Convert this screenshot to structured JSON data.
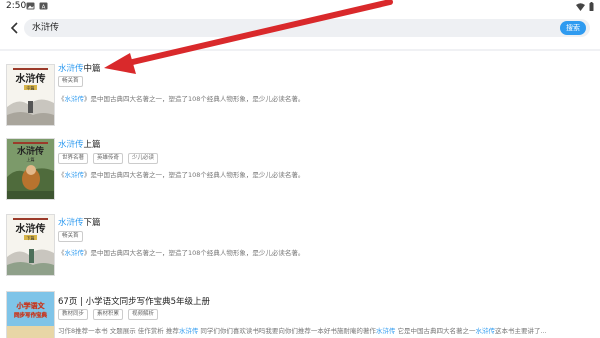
{
  "status": {
    "time": "2:50"
  },
  "search": {
    "query": "水浒传",
    "button_label": "搜索"
  },
  "results": [
    {
      "title_hl": "水浒传",
      "title_rest": "中篇",
      "tags": [
        "畅关首"
      ],
      "desc_pre": "《",
      "desc_hl": "水浒传",
      "desc_post": "》是中国古典四大名著之一，塑造了108个经典人物形象，是少儿必读名著。",
      "cover_title": "水浒传",
      "cover_sub": "中篇"
    },
    {
      "title_hl": "水浒传",
      "title_rest": "上篇",
      "tags": [
        "世界名著",
        "英雄传奇",
        "少儿必读"
      ],
      "desc_pre": "《",
      "desc_hl": "水浒传",
      "desc_post": "》是中国古典四大名著之一，塑造了108个经典人物形象，是少儿必读名著。",
      "cover_title": "水浒传",
      "cover_sub": "上篇"
    },
    {
      "title_hl": "水浒传",
      "title_rest": "下篇",
      "tags": [
        "畅关首"
      ],
      "desc_pre": "《",
      "desc_hl": "水浒传",
      "desc_post": "》是中国古典四大名著之一，塑造了108个经典人物形象，是少儿必读名著。",
      "cover_title": "水浒传",
      "cover_sub": "下篇"
    },
    {
      "title_pre": "67页 | 小学语文同步写作宝典5年级上册",
      "tags": [
        "教材同步",
        "素材积累",
        "视频解析"
      ],
      "desc_a": "习作8推荐一本书 文题展示 佳作赏析 推荐",
      "desc_hl1": "水浒传",
      "desc_b": " 同学们你们喜欢读书吗我要向你们推荐一本好书施耐庵的著作",
      "desc_hl2": "水浒传",
      "desc_c": " 它是中国古典四大名著之一",
      "desc_hl3": "水浒传",
      "desc_d": "这本书主要讲了...",
      "cover_line1": "小学语文",
      "cover_line2": "同步写作宝典"
    }
  ],
  "colors": {
    "accent": "#2f9bf0",
    "arrow": "#d9292b"
  }
}
